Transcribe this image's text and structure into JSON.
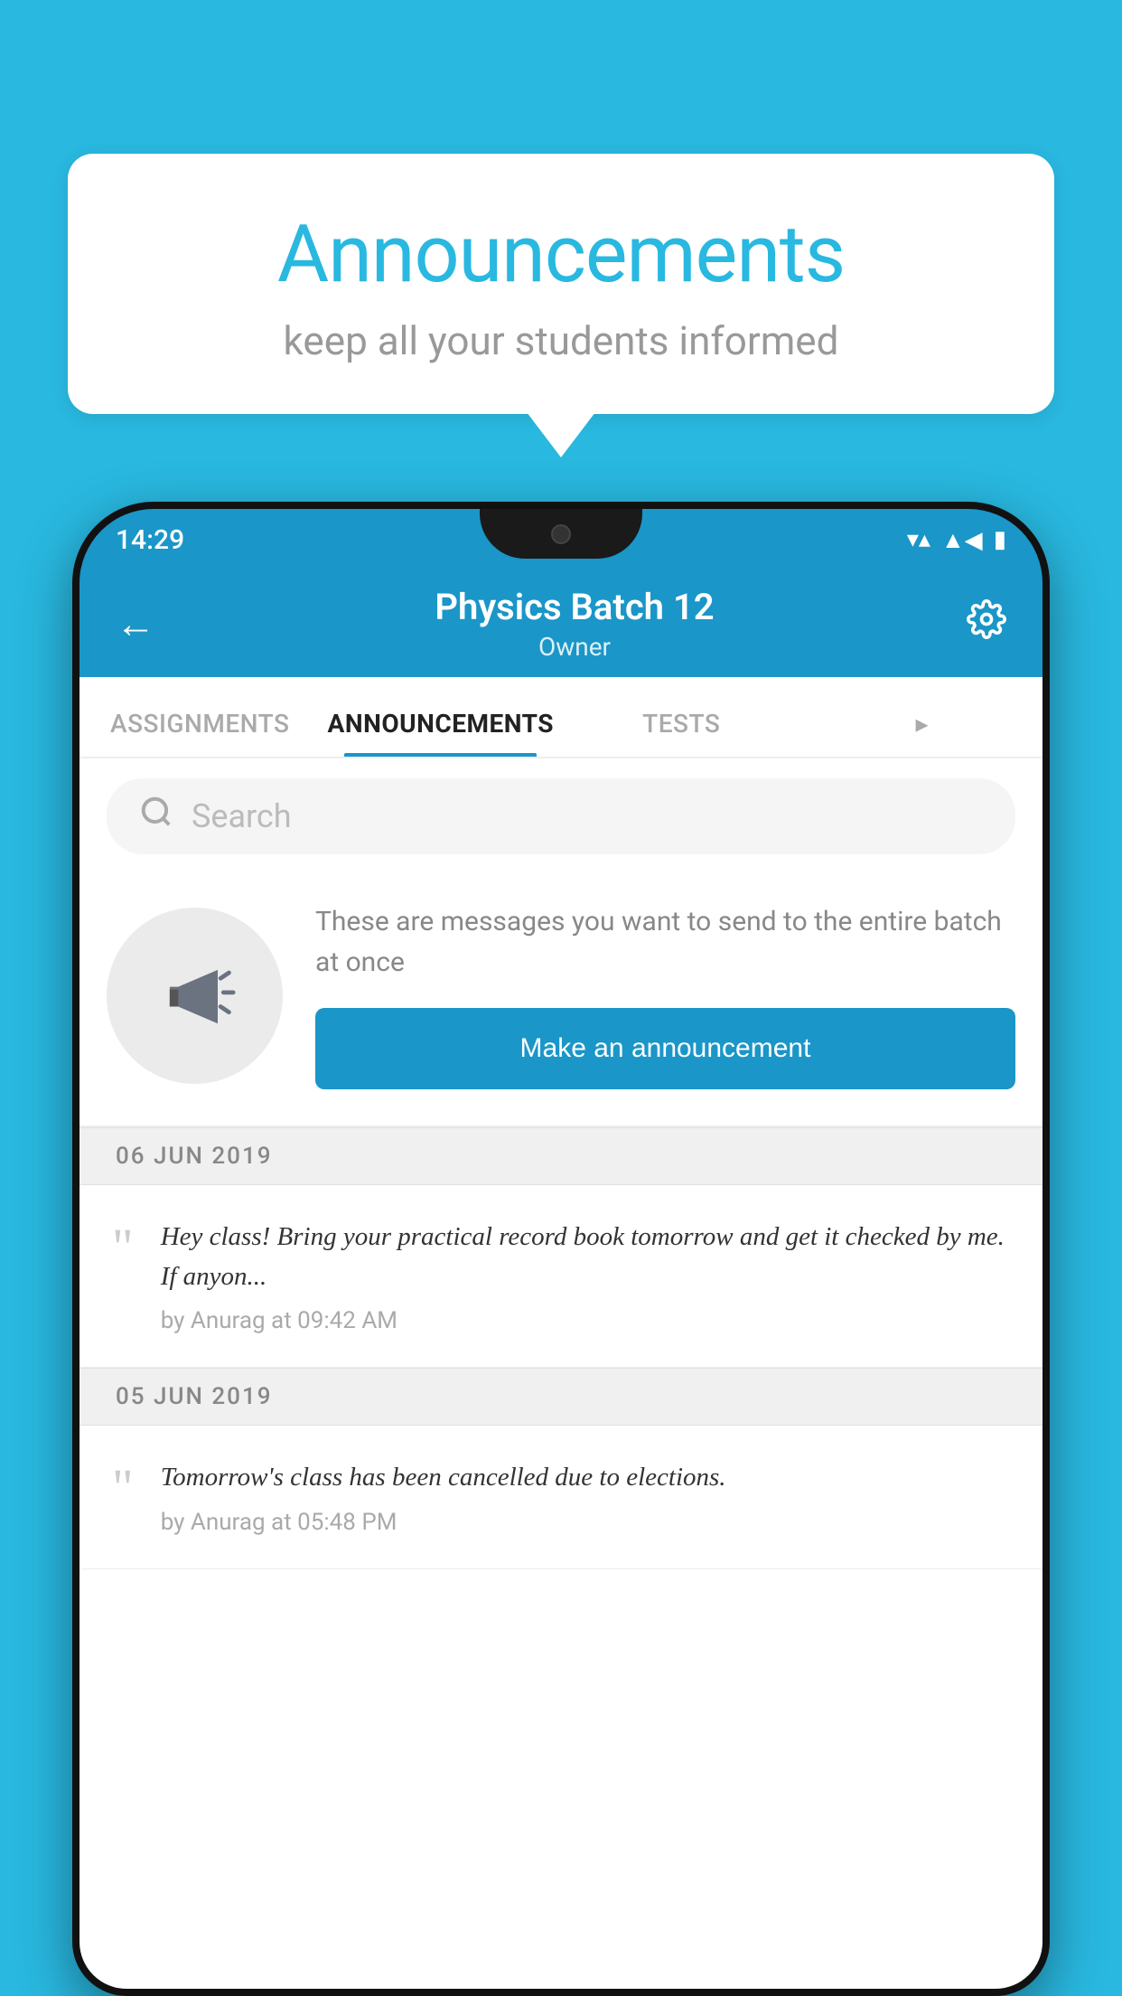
{
  "background_color": "#29b8e0",
  "bubble": {
    "title": "Announcements",
    "subtitle": "keep all your students informed"
  },
  "phone": {
    "status_bar": {
      "time": "14:29",
      "signal_icon": "▲",
      "wifi_icon": "▼",
      "battery_icon": "▮"
    },
    "header": {
      "back_label": "←",
      "title": "Physics Batch 12",
      "subtitle": "Owner",
      "settings_icon": "⚙"
    },
    "tabs": [
      {
        "label": "ASSIGNMENTS",
        "active": false
      },
      {
        "label": "ANNOUNCEMENTS",
        "active": true
      },
      {
        "label": "TESTS",
        "active": false
      },
      {
        "label": "...",
        "active": false
      }
    ],
    "search": {
      "placeholder": "Search"
    },
    "prompt": {
      "description": "These are messages you want to send to the entire batch at once",
      "button_label": "Make an announcement"
    },
    "messages": [
      {
        "date": "06  JUN  2019",
        "text": "Hey class! Bring your practical record book tomorrow and get it checked by me. If anyon...",
        "meta": "by Anurag at 09:42 AM"
      },
      {
        "date": "05  JUN  2019",
        "text": "Tomorrow's class has been cancelled due to elections.",
        "meta": "by Anurag at 05:48 PM"
      }
    ]
  }
}
